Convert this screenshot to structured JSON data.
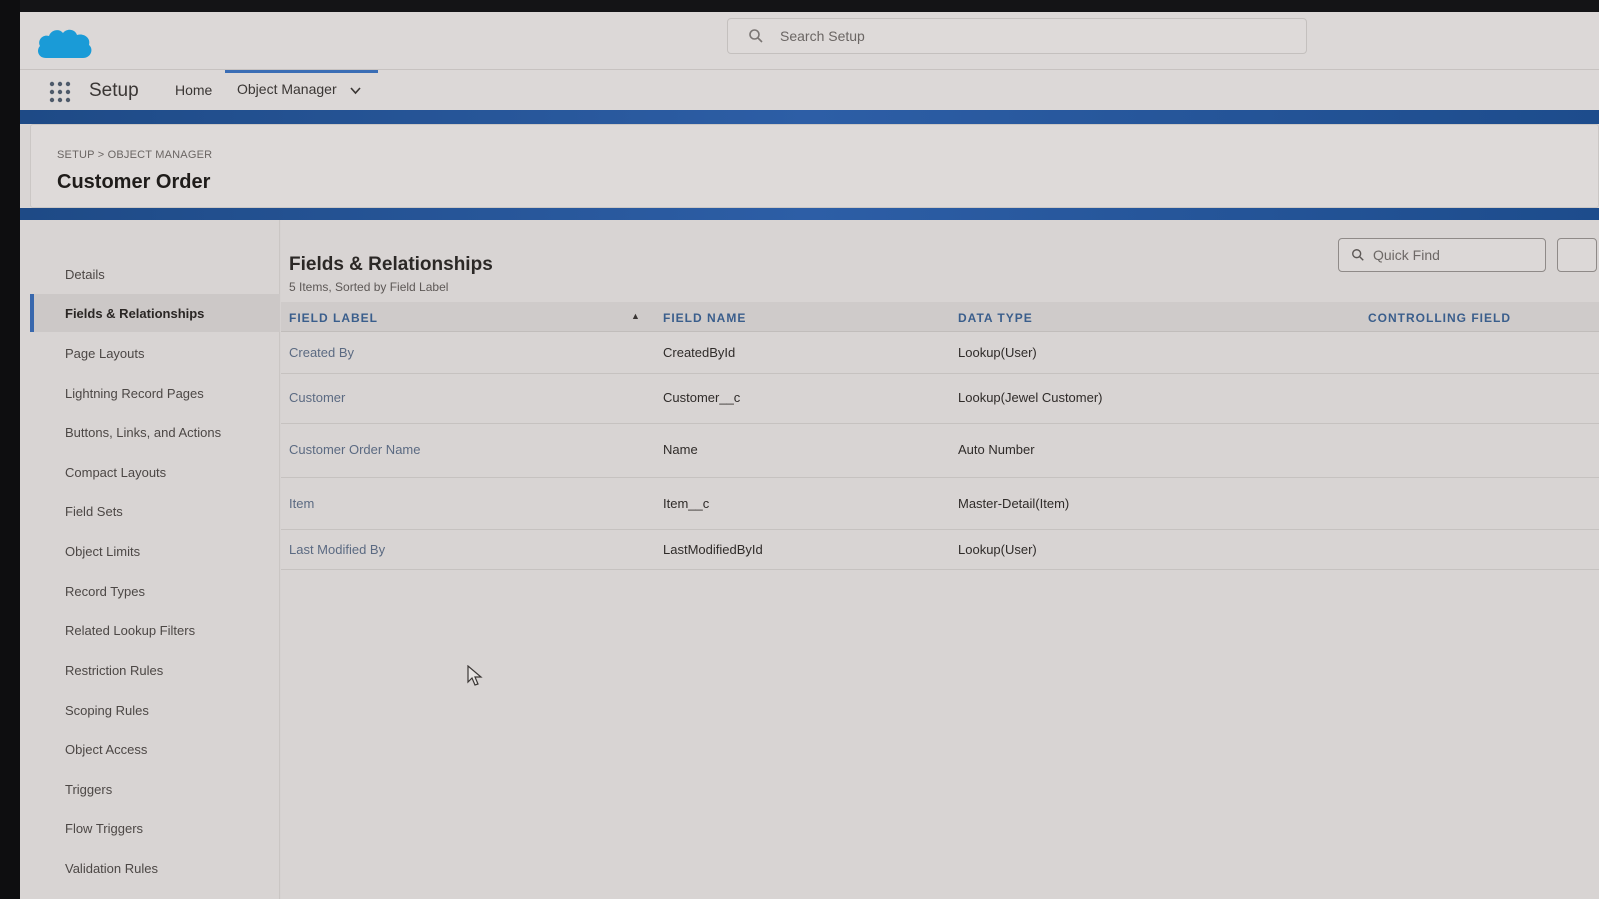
{
  "header": {
    "search_placeholder": "Search Setup"
  },
  "nav": {
    "app_name": "Setup",
    "home": "Home",
    "object_manager": "Object Manager"
  },
  "object": {
    "breadcrumb": "SETUP > OBJECT MANAGER",
    "title": "Customer Order"
  },
  "sidebar": {
    "items": [
      {
        "label": "Details"
      },
      {
        "label": "Fields & Relationships",
        "active": true
      },
      {
        "label": "Page Layouts"
      },
      {
        "label": "Lightning Record Pages"
      },
      {
        "label": "Buttons, Links, and Actions"
      },
      {
        "label": "Compact Layouts"
      },
      {
        "label": "Field Sets"
      },
      {
        "label": "Object Limits"
      },
      {
        "label": "Record Types"
      },
      {
        "label": "Related Lookup Filters"
      },
      {
        "label": "Restriction Rules"
      },
      {
        "label": "Scoping Rules"
      },
      {
        "label": "Object Access"
      },
      {
        "label": "Triggers"
      },
      {
        "label": "Flow Triggers"
      },
      {
        "label": "Validation Rules"
      }
    ]
  },
  "section": {
    "title": "Fields & Relationships",
    "subtitle": "5 Items, Sorted by Field Label",
    "quick_find_placeholder": "Quick Find"
  },
  "table": {
    "columns": [
      "FIELD LABEL",
      "FIELD NAME",
      "DATA TYPE",
      "CONTROLLING FIELD"
    ],
    "rows": [
      {
        "label": "Created By",
        "name": "CreatedById",
        "type": "Lookup(User)",
        "controlling": ""
      },
      {
        "label": "Customer",
        "name": "Customer__c",
        "type": "Lookup(Jewel Customer)",
        "controlling": ""
      },
      {
        "label": "Customer Order Name",
        "name": "Name",
        "type": "Auto Number",
        "controlling": ""
      },
      {
        "label": "Item",
        "name": "Item__c",
        "type": "Master-Detail(Item)",
        "controlling": ""
      },
      {
        "label": "Last Modified By",
        "name": "LastModifiedById",
        "type": "Lookup(User)",
        "controlling": ""
      }
    ]
  },
  "colors": {
    "brand_blue": "#2d5ea6",
    "cloud_blue": "#1a9bd7",
    "header_text_blue": "#3a5e8c"
  },
  "icons": {
    "logo": "salesforce-cloud-logo",
    "search": "search-icon",
    "apps": "app-launcher-icon",
    "dropdown": "chevron-down-icon"
  }
}
